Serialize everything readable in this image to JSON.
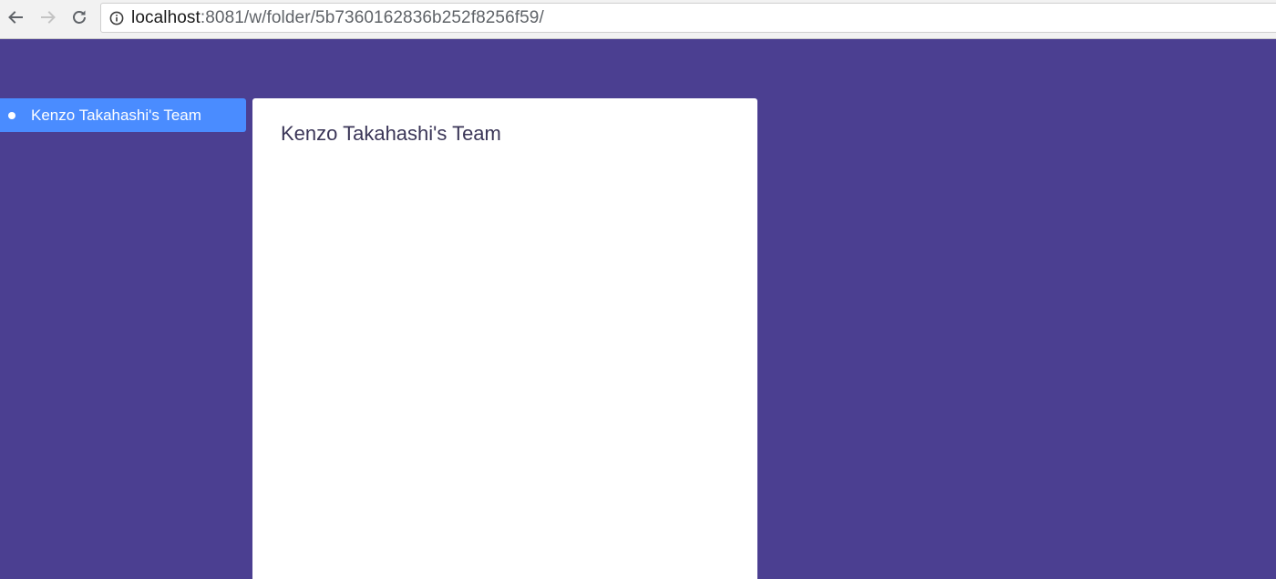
{
  "browser": {
    "url_host": "localhost",
    "url_rest": ":8081/w/folder/5b7360162836b252f8256f59/",
    "icons": {
      "back": "arrow-left-icon",
      "forward": "arrow-right-icon",
      "reload": "reload-icon",
      "info": "info-circle-icon"
    }
  },
  "sidebar": {
    "items": [
      {
        "label": "Kenzo Takahashi's Team",
        "active": true
      }
    ]
  },
  "main": {
    "title": "Kenzo Takahashi's Team"
  },
  "colors": {
    "background": "#4b3f91",
    "sidebar_active": "#4a8cff",
    "panel": "#ffffff",
    "title_text": "#3a3557"
  }
}
